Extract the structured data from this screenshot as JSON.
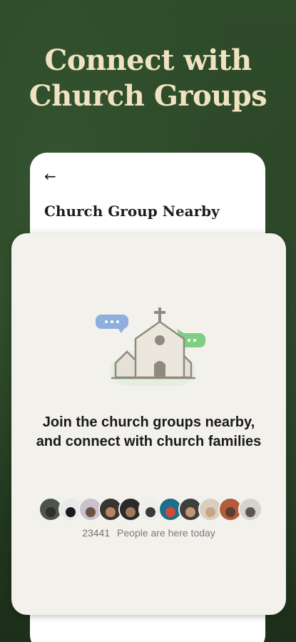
{
  "headline": {
    "line1": "Connect with",
    "line2": "Church Groups"
  },
  "screen": {
    "back_icon": "arrow-left-icon",
    "title": "Church Group Nearby"
  },
  "card": {
    "illustration": "church-with-chat-bubbles-icon",
    "message": "Join the church groups nearby, and connect with church families",
    "members": {
      "count": "23441",
      "label": "People are here today",
      "avatar_count": 11
    }
  },
  "colors": {
    "background": "#2a4527",
    "headline": "#efe3c2",
    "bubble_blue": "#8eaedd",
    "bubble_green": "#7fcf83"
  }
}
